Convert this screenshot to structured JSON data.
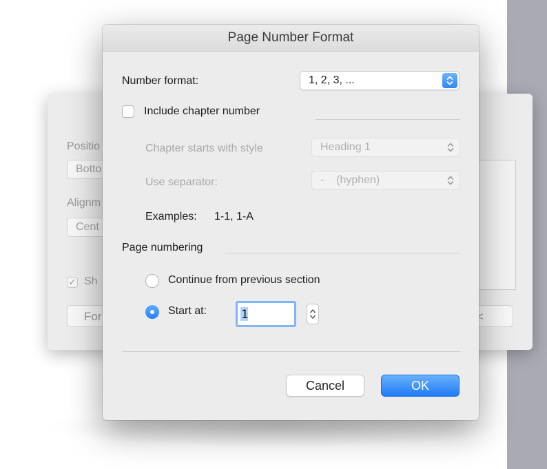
{
  "background_dialog": {
    "position_label": "Positio",
    "position_value": "Botto",
    "alignment_label": "Alignm",
    "alignment_value": "Cent",
    "show_label": "Sh",
    "format_button": "For",
    "close_glyph": "<"
  },
  "dialog": {
    "title": "Page Number Format",
    "number_format": {
      "label": "Number format:",
      "value": "1, 2, 3, ..."
    },
    "include_chapter": {
      "label": "Include chapter number",
      "checked": false
    },
    "chapter_style": {
      "label": "Chapter starts with style",
      "value": "Heading 1",
      "enabled": false
    },
    "separator": {
      "label": "Use separator:",
      "value": "-    (hyphen)",
      "enabled": false
    },
    "examples": {
      "label": "Examples:",
      "value": "1-1, 1-A"
    },
    "page_numbering": {
      "label": "Page numbering",
      "continue_option": "Continue from previous section",
      "start_at_option": "Start at:",
      "selected": "start_at",
      "start_value": "1"
    },
    "buttons": {
      "cancel": "Cancel",
      "ok": "OK"
    }
  },
  "colors": {
    "accent": "#2e86f6",
    "dialog_bg": "#ececec",
    "sidebar": "#a9aab4"
  },
  "icons": [
    "chevron-updown-icon",
    "stepper-icon",
    "checkmark-icon"
  ]
}
